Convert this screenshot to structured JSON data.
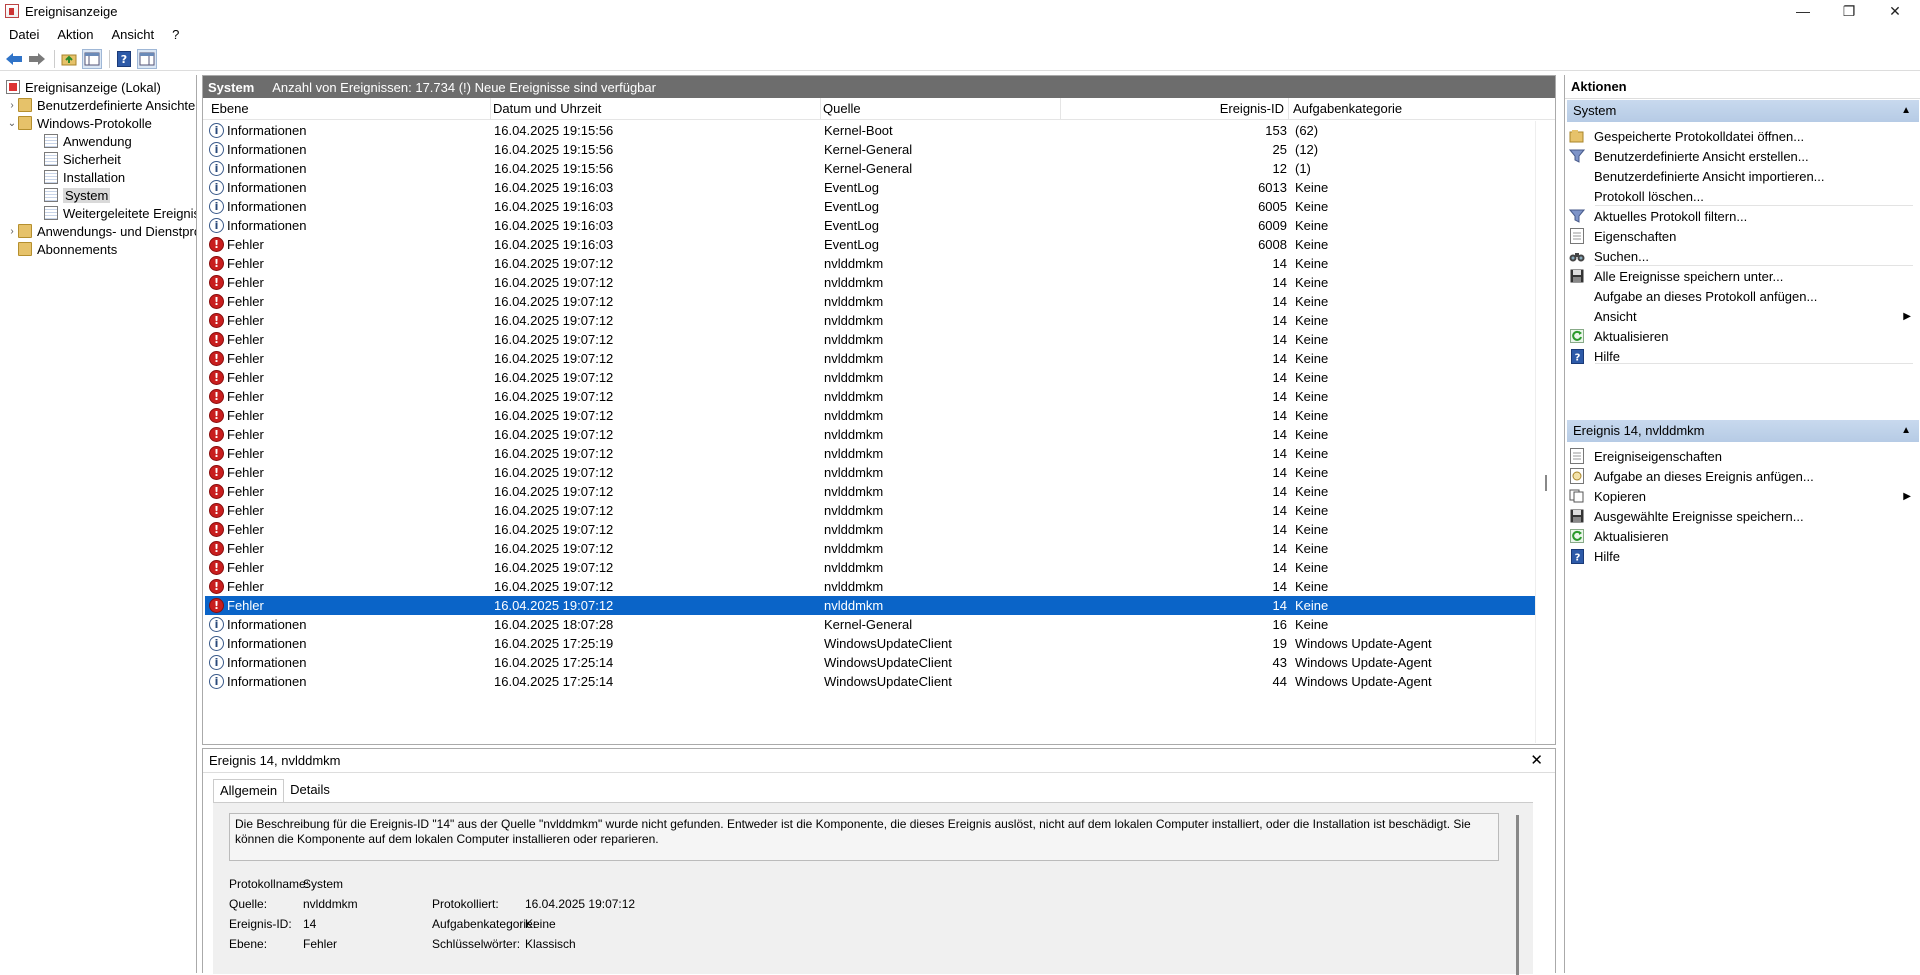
{
  "window": {
    "title": "Ereignisanzeige",
    "controls": {
      "minimize": "—",
      "maximize": "❐",
      "close": "✕"
    }
  },
  "menu": [
    "Datei",
    "Aktion",
    "Ansicht",
    "?"
  ],
  "tree": {
    "root": "Ereignisanzeige (Lokal)",
    "custom_views": "Benutzerdefinierte Ansichten",
    "windows_logs": "Windows-Protokolle",
    "logs": [
      "Anwendung",
      "Sicherheit",
      "Installation",
      "System",
      "Weitergeleitete Ereignisse"
    ],
    "app_services": "Anwendungs- und Dienstprotokolle",
    "subscriptions": "Abonnements"
  },
  "list": {
    "header_title": "System",
    "header_info": "Anzahl von Ereignissen: 17.734 (!) Neue Ereignisse sind verfügbar",
    "columns": [
      "Ebene",
      "Datum und Uhrzeit",
      "Quelle",
      "Ereignis-ID",
      "Aufgabenkategorie"
    ],
    "rows": [
      {
        "level": "Informationen",
        "type": "info",
        "date": "16.04.2025 19:15:56",
        "source": "Kernel-Boot",
        "id": "153",
        "category": "(62)"
      },
      {
        "level": "Informationen",
        "type": "info",
        "date": "16.04.2025 19:15:56",
        "source": "Kernel-General",
        "id": "25",
        "category": "(12)"
      },
      {
        "level": "Informationen",
        "type": "info",
        "date": "16.04.2025 19:15:56",
        "source": "Kernel-General",
        "id": "12",
        "category": "(1)"
      },
      {
        "level": "Informationen",
        "type": "info",
        "date": "16.04.2025 19:16:03",
        "source": "EventLog",
        "id": "6013",
        "category": "Keine"
      },
      {
        "level": "Informationen",
        "type": "info",
        "date": "16.04.2025 19:16:03",
        "source": "EventLog",
        "id": "6005",
        "category": "Keine"
      },
      {
        "level": "Informationen",
        "type": "info",
        "date": "16.04.2025 19:16:03",
        "source": "EventLog",
        "id": "6009",
        "category": "Keine"
      },
      {
        "level": "Fehler",
        "type": "error",
        "date": "16.04.2025 19:16:03",
        "source": "EventLog",
        "id": "6008",
        "category": "Keine"
      },
      {
        "level": "Fehler",
        "type": "error",
        "date": "16.04.2025 19:07:12",
        "source": "nvlddmkm",
        "id": "14",
        "category": "Keine"
      },
      {
        "level": "Fehler",
        "type": "error",
        "date": "16.04.2025 19:07:12",
        "source": "nvlddmkm",
        "id": "14",
        "category": "Keine"
      },
      {
        "level": "Fehler",
        "type": "error",
        "date": "16.04.2025 19:07:12",
        "source": "nvlddmkm",
        "id": "14",
        "category": "Keine"
      },
      {
        "level": "Fehler",
        "type": "error",
        "date": "16.04.2025 19:07:12",
        "source": "nvlddmkm",
        "id": "14",
        "category": "Keine"
      },
      {
        "level": "Fehler",
        "type": "error",
        "date": "16.04.2025 19:07:12",
        "source": "nvlddmkm",
        "id": "14",
        "category": "Keine"
      },
      {
        "level": "Fehler",
        "type": "error",
        "date": "16.04.2025 19:07:12",
        "source": "nvlddmkm",
        "id": "14",
        "category": "Keine"
      },
      {
        "level": "Fehler",
        "type": "error",
        "date": "16.04.2025 19:07:12",
        "source": "nvlddmkm",
        "id": "14",
        "category": "Keine"
      },
      {
        "level": "Fehler",
        "type": "error",
        "date": "16.04.2025 19:07:12",
        "source": "nvlddmkm",
        "id": "14",
        "category": "Keine"
      },
      {
        "level": "Fehler",
        "type": "error",
        "date": "16.04.2025 19:07:12",
        "source": "nvlddmkm",
        "id": "14",
        "category": "Keine"
      },
      {
        "level": "Fehler",
        "type": "error",
        "date": "16.04.2025 19:07:12",
        "source": "nvlddmkm",
        "id": "14",
        "category": "Keine"
      },
      {
        "level": "Fehler",
        "type": "error",
        "date": "16.04.2025 19:07:12",
        "source": "nvlddmkm",
        "id": "14",
        "category": "Keine"
      },
      {
        "level": "Fehler",
        "type": "error",
        "date": "16.04.2025 19:07:12",
        "source": "nvlddmkm",
        "id": "14",
        "category": "Keine"
      },
      {
        "level": "Fehler",
        "type": "error",
        "date": "16.04.2025 19:07:12",
        "source": "nvlddmkm",
        "id": "14",
        "category": "Keine"
      },
      {
        "level": "Fehler",
        "type": "error",
        "date": "16.04.2025 19:07:12",
        "source": "nvlddmkm",
        "id": "14",
        "category": "Keine"
      },
      {
        "level": "Fehler",
        "type": "error",
        "date": "16.04.2025 19:07:12",
        "source": "nvlddmkm",
        "id": "14",
        "category": "Keine"
      },
      {
        "level": "Fehler",
        "type": "error",
        "date": "16.04.2025 19:07:12",
        "source": "nvlddmkm",
        "id": "14",
        "category": "Keine"
      },
      {
        "level": "Fehler",
        "type": "error",
        "date": "16.04.2025 19:07:12",
        "source": "nvlddmkm",
        "id": "14",
        "category": "Keine"
      },
      {
        "level": "Fehler",
        "type": "error",
        "date": "16.04.2025 19:07:12",
        "source": "nvlddmkm",
        "id": "14",
        "category": "Keine"
      },
      {
        "level": "Fehler",
        "type": "error",
        "date": "16.04.2025 19:07:12",
        "source": "nvlddmkm",
        "id": "14",
        "category": "Keine",
        "selected": true
      },
      {
        "level": "Informationen",
        "type": "info",
        "date": "16.04.2025 18:07:28",
        "source": "Kernel-General",
        "id": "16",
        "category": "Keine"
      },
      {
        "level": "Informationen",
        "type": "info",
        "date": "16.04.2025 17:25:19",
        "source": "WindowsUpdateClient",
        "id": "19",
        "category": "Windows Update-Agent"
      },
      {
        "level": "Informationen",
        "type": "info",
        "date": "16.04.2025 17:25:14",
        "source": "WindowsUpdateClient",
        "id": "43",
        "category": "Windows Update-Agent"
      },
      {
        "level": "Informationen",
        "type": "info",
        "date": "16.04.2025 17:25:14",
        "source": "WindowsUpdateClient",
        "id": "44",
        "category": "Windows Update-Agent"
      }
    ]
  },
  "detail": {
    "title": "Ereignis 14, nvlddmkm",
    "close": "✕",
    "tabs": [
      "Allgemein",
      "Details"
    ],
    "description": "Die Beschreibung für die Ereignis-ID \"14\" aus der Quelle \"nvlddmkm\" wurde nicht gefunden. Entweder ist die Komponente, die dieses Ereignis auslöst, nicht auf dem lokalen Computer installiert, oder die Installation ist beschädigt. Sie können die Komponente auf dem lokalen Computer installieren oder reparieren.",
    "fields": {
      "log_name_label": "Protokollname:",
      "log_name": "System",
      "source_label": "Quelle:",
      "source": "nvlddmkm",
      "logged_label": "Protokolliert:",
      "logged": "16.04.2025 19:07:12",
      "event_id_label": "Ereignis-ID:",
      "event_id": "14",
      "task_label": "Aufgabenkategorie:",
      "task": "Keine",
      "level_label": "Ebene:",
      "level": "Fehler",
      "keywords_label": "Schlüsselwörter:",
      "keywords": "Klassisch"
    }
  },
  "actions": {
    "title": "Aktionen",
    "section1": "System",
    "section1_items": [
      {
        "label": "Gespeicherte Protokolldatei öffnen...",
        "icon": "open-folder-icon"
      },
      {
        "label": "Benutzerdefinierte Ansicht erstellen...",
        "icon": "filter-icon"
      },
      {
        "label": "Benutzerdefinierte Ansicht importieren...",
        "icon": ""
      },
      {
        "label": "Protokoll löschen...",
        "icon": ""
      },
      {
        "label": "Aktuelles Protokoll filtern...",
        "icon": "filter-icon"
      },
      {
        "label": "Eigenschaften",
        "icon": "properties-icon"
      },
      {
        "label": "Suchen...",
        "icon": "binoculars-icon"
      },
      {
        "label": "Alle Ereignisse speichern unter...",
        "icon": "save-icon"
      },
      {
        "label": "Aufgabe an dieses Protokoll anfügen...",
        "icon": ""
      },
      {
        "label": "Ansicht",
        "icon": "",
        "submenu": true
      },
      {
        "label": "Aktualisieren",
        "icon": "refresh-icon"
      },
      {
        "label": "Hilfe",
        "icon": "help-icon"
      }
    ],
    "section2": "Ereignis 14, nvlddmkm",
    "section2_items": [
      {
        "label": "Ereigniseigenschaften",
        "icon": "properties-icon"
      },
      {
        "label": "Aufgabe an dieses Ereignis anfügen...",
        "icon": "task-icon"
      },
      {
        "label": "Kopieren",
        "icon": "copy-icon",
        "submenu": true
      },
      {
        "label": "Ausgewählte Ereignisse speichern...",
        "icon": "save-icon"
      },
      {
        "label": "Aktualisieren",
        "icon": "refresh-icon"
      },
      {
        "label": "Hilfe",
        "icon": "help-icon"
      }
    ]
  },
  "colors": {
    "selected_row": "#0a64c8",
    "header_bar": "#6d6d6d",
    "section_head": "#c8d9ee",
    "error": "#c81e1e"
  }
}
